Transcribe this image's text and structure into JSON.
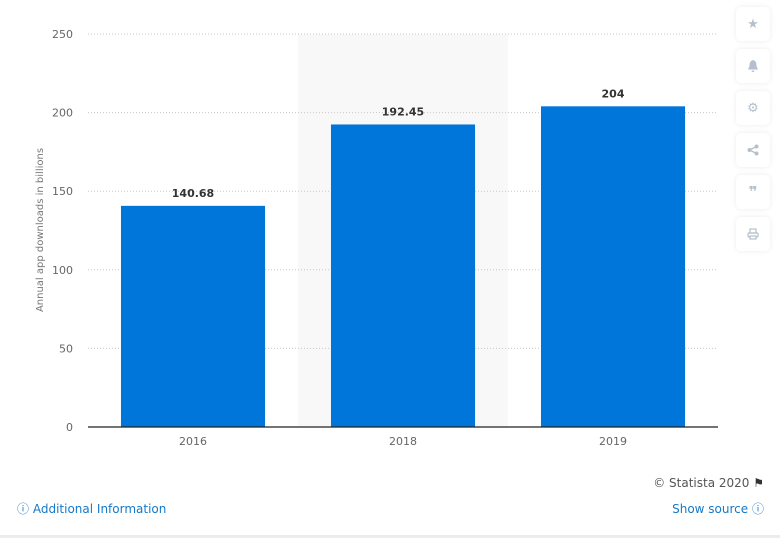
{
  "chart_data": {
    "type": "bar",
    "title": "",
    "xlabel": "",
    "ylabel": "Annual app downloads in billions",
    "categories": [
      "2016",
      "2018",
      "2019"
    ],
    "values": [
      140.68,
      192.45,
      204
    ],
    "data_labels": [
      "140.68",
      "192.45",
      "204"
    ],
    "ylim": [
      0,
      250
    ],
    "yticks": [
      0,
      50,
      100,
      150,
      200,
      250
    ],
    "grid": true,
    "highlighted_category": "2018",
    "bar_color": "#0076DA"
  },
  "sidebar": {
    "buttons": [
      {
        "name": "favorite",
        "icon": "star-icon",
        "glyph": "★"
      },
      {
        "name": "notification",
        "icon": "bell-icon",
        "glyph": "🔔"
      },
      {
        "name": "settings",
        "icon": "gear-icon",
        "glyph": "⚙"
      },
      {
        "name": "share",
        "icon": "share-icon",
        "glyph": "<"
      },
      {
        "name": "cite",
        "icon": "quote-icon",
        "glyph": "❞"
      },
      {
        "name": "print",
        "icon": "print-icon",
        "glyph": "⎙"
      }
    ]
  },
  "footer": {
    "copyright": "© Statista 2020",
    "additional_info": "Additional Information",
    "show_source": "Show source"
  }
}
